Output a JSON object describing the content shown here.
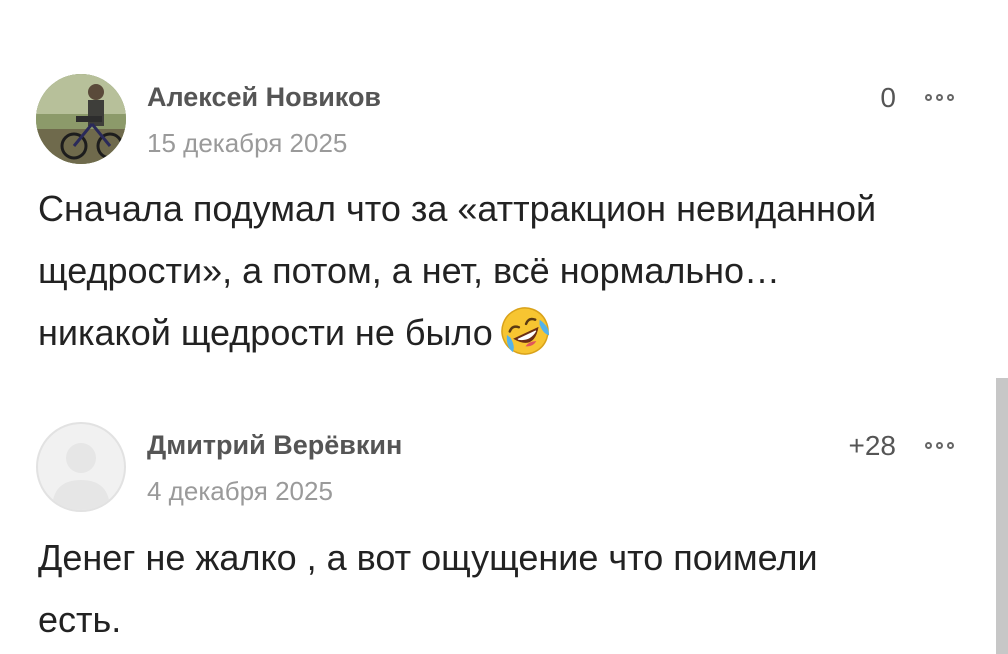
{
  "comments": [
    {
      "author": "Алексей Новиков",
      "date": "15 декабря 2025",
      "rating": "0",
      "lines": [
        "Сначала подумал что за «аттракцион невиданной",
        "щедрости», а потом, а нет, всё нормально…",
        "никакой щедрости не было"
      ],
      "emoji": "rolling-on-floor-laughing-icon"
    },
    {
      "author": "Дмитрий Верёвкин",
      "date": "4 декабря 2025",
      "rating": "+28",
      "lines": [
        "Денег не жалко , а вот ощущение что поимели",
        "есть."
      ]
    }
  ],
  "colors": {
    "author": "#555555",
    "date": "#9a9a9a",
    "body": "#222222",
    "scrollbar": "#c7c7c7"
  }
}
